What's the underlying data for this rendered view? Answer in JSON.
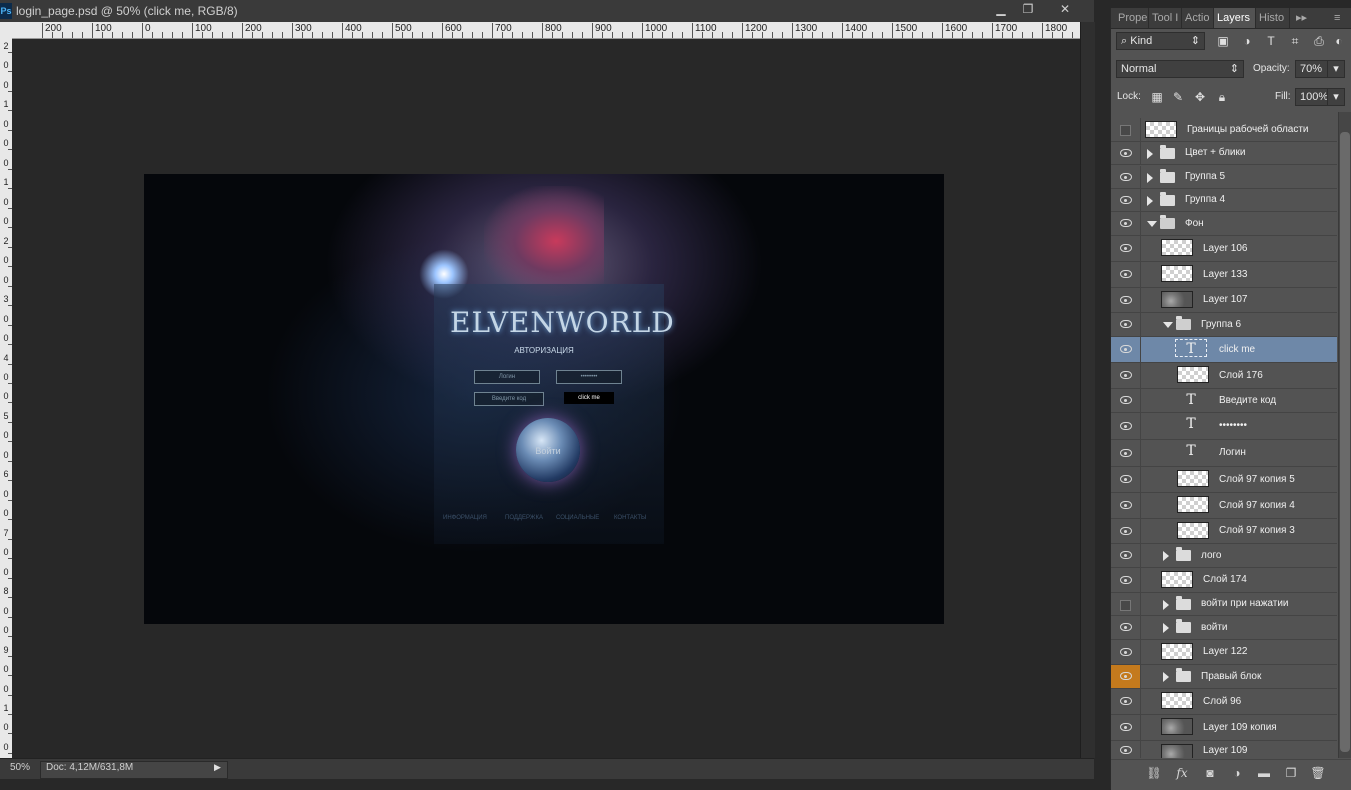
{
  "window": {
    "app_badge": "Ps",
    "title": "login_page.psd @ 50% (click me, RGB/8)",
    "controls": {
      "minimize": "▁",
      "maximize": "❐",
      "close": "✕"
    }
  },
  "ruler": {
    "top_labels": [
      "200",
      "100",
      "0",
      "100",
      "200",
      "300",
      "400",
      "500",
      "600",
      "700",
      "800",
      "900",
      "1000",
      "1100",
      "1200",
      "1300",
      "1400",
      "1500",
      "1600",
      "1700",
      "1800"
    ],
    "left_labels": [
      "2",
      "0",
      "0",
      "1",
      "0",
      "0",
      "0",
      "1",
      "0",
      "0",
      "2",
      "0",
      "0",
      "3",
      "0",
      "0",
      "4",
      "0",
      "0",
      "5",
      "0",
      "0",
      "6",
      "0",
      "0",
      "7",
      "0",
      "0",
      "8",
      "0",
      "0",
      "9",
      "0",
      "0",
      "1",
      "0",
      "0"
    ]
  },
  "artwork": {
    "logo": "ELVENWORLD",
    "subtitle": "АВТОРИЗАЦИЯ",
    "login_field": "Логин",
    "password_field": "••••••••",
    "code_field": "Введите код",
    "click_me": "click me",
    "orb_label": "Войти",
    "nav": [
      "ИНФОРМАЦИЯ",
      "ПОДДЕРЖКА",
      "СОЦИАЛЬНЫЕ",
      "КОНТАКТЫ"
    ]
  },
  "status": {
    "zoom": "50%",
    "doc_size": "Doc: 4,12M/631,8M",
    "arrow": "▶"
  },
  "panel": {
    "tabs": [
      "Prope",
      "Tool I",
      "Actio",
      "Layers",
      "Histo"
    ],
    "active_tab": "Layers",
    "collapse_icon": "▸▸",
    "menu_icon": "≡",
    "filter_kind": "Kind",
    "blend_mode": "Normal",
    "opacity_label": "Opacity:",
    "opacity_value": "70%",
    "lock_label": "Lock:",
    "fill_label": "Fill:",
    "fill_value": "100%",
    "layers": [
      {
        "name": "Границы рабочей области",
        "type": "layer",
        "visible": false,
        "indent": 0
      },
      {
        "name": "Цвет + блики",
        "type": "group",
        "open": false,
        "visible": true,
        "indent": 0
      },
      {
        "name": "Группа 5",
        "type": "group",
        "open": false,
        "visible": true,
        "indent": 0
      },
      {
        "name": "Группа 4",
        "type": "group",
        "open": false,
        "visible": true,
        "indent": 0
      },
      {
        "name": "Фон",
        "type": "group",
        "open": true,
        "visible": true,
        "indent": 0
      },
      {
        "name": "Layer 106",
        "type": "layer",
        "visible": true,
        "indent": 1
      },
      {
        "name": "Layer 133",
        "type": "layer",
        "visible": true,
        "indent": 1
      },
      {
        "name": "Layer 107",
        "type": "layer",
        "visible": true,
        "indent": 1,
        "dark": true
      },
      {
        "name": "Группа 6",
        "type": "group",
        "open": true,
        "visible": true,
        "indent": 1
      },
      {
        "name": "click me",
        "type": "text",
        "visible": true,
        "indent": 2,
        "selected": true
      },
      {
        "name": "Слой 176",
        "type": "layer",
        "visible": true,
        "indent": 2
      },
      {
        "name": "Введите код",
        "type": "text",
        "visible": true,
        "indent": 2
      },
      {
        "name": "••••••••",
        "type": "text",
        "visible": true,
        "indent": 2
      },
      {
        "name": "Логин",
        "type": "text",
        "visible": true,
        "indent": 2
      },
      {
        "name": "Слой 97 копия 5",
        "type": "layer",
        "visible": true,
        "indent": 2
      },
      {
        "name": "Слой 97 копия 4",
        "type": "layer",
        "visible": true,
        "indent": 2
      },
      {
        "name": "Слой 97 копия 3",
        "type": "layer",
        "visible": true,
        "indent": 2
      },
      {
        "name": "лого",
        "type": "group",
        "open": false,
        "visible": true,
        "indent": 1
      },
      {
        "name": "Слой 174",
        "type": "layer",
        "visible": true,
        "indent": 1
      },
      {
        "name": "войти при нажатии",
        "type": "group",
        "open": false,
        "visible": false,
        "indent": 1
      },
      {
        "name": "войти",
        "type": "group",
        "open": false,
        "visible": true,
        "indent": 1
      },
      {
        "name": "Layer 122",
        "type": "layer",
        "visible": true,
        "indent": 1
      },
      {
        "name": "Правый блок",
        "type": "group",
        "open": false,
        "visible": true,
        "indent": 1,
        "highlight": true
      },
      {
        "name": "Слой 96",
        "type": "layer",
        "visible": true,
        "indent": 1
      },
      {
        "name": "Layer 109 копия",
        "type": "layer",
        "visible": true,
        "indent": 1,
        "dark": true
      },
      {
        "name": "Layer 109",
        "type": "layer",
        "visible": true,
        "indent": 1,
        "dark": true
      }
    ],
    "bottom_icons": [
      "link-icon",
      "fx-icon",
      "mask-icon",
      "adjustment-icon",
      "folder-icon",
      "new-layer-icon",
      "trash-icon"
    ]
  }
}
